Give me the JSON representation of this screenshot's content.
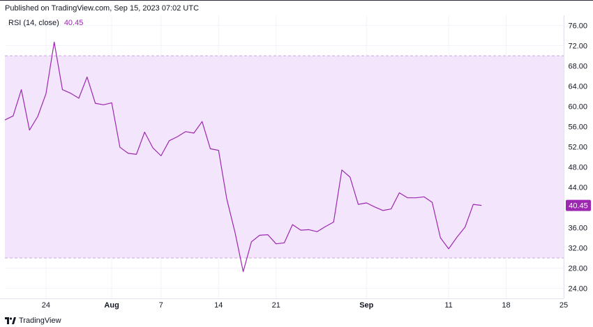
{
  "header": {
    "published_text": "Published on TradingView.com, Sep 15, 2023 07:02 UTC"
  },
  "indicator": {
    "label": "RSI (14, close)",
    "value": "40.45"
  },
  "footer": {
    "brand": "TradingView"
  },
  "colors": {
    "line": "#9c27b0",
    "band_fill": "#f3e5fc",
    "band_border": "#c9a6dd",
    "badge": "#9c27b0",
    "grid": "#f0f3fa"
  },
  "chart_data": {
    "type": "line",
    "title": "RSI (14, close)",
    "xlabel": "",
    "ylabel": "",
    "ylim": [
      22,
      78
    ],
    "y_ticks": [
      "24.00",
      "28.00",
      "32.00",
      "36.00",
      "40.00",
      "44.00",
      "48.00",
      "52.00",
      "56.00",
      "60.00",
      "64.00",
      "68.00",
      "72.00",
      "76.00"
    ],
    "x_ticks": [
      {
        "label": "24",
        "x": "2023-07-24",
        "bold": false
      },
      {
        "label": "Aug",
        "x": "2023-08-01",
        "bold": true
      },
      {
        "label": "7",
        "x": "2023-08-07",
        "bold": false
      },
      {
        "label": "14",
        "x": "2023-08-14",
        "bold": false
      },
      {
        "label": "21",
        "x": "2023-08-21",
        "bold": false
      },
      {
        "label": "Sep",
        "x": "2023-09-01",
        "bold": true
      },
      {
        "label": "11",
        "x": "2023-09-11",
        "bold": false
      },
      {
        "label": "18",
        "x": "2023-09-18",
        "bold": false
      },
      {
        "label": "25",
        "x": "2023-09-25",
        "bold": false
      }
    ],
    "x_range": [
      "2023-07-19",
      "2023-09-25"
    ],
    "band": {
      "upper": 70,
      "lower": 30
    },
    "last_value_label": "40.45",
    "grid": true,
    "series": [
      {
        "name": "RSI (14, close)",
        "x": [
          "2023-07-19",
          "2023-07-20",
          "2023-07-21",
          "2023-07-22",
          "2023-07-23",
          "2023-07-24",
          "2023-07-25",
          "2023-07-26",
          "2023-07-27",
          "2023-07-28",
          "2023-07-29",
          "2023-07-30",
          "2023-07-31",
          "2023-08-01",
          "2023-08-02",
          "2023-08-03",
          "2023-08-04",
          "2023-08-05",
          "2023-08-06",
          "2023-08-07",
          "2023-08-08",
          "2023-08-09",
          "2023-08-10",
          "2023-08-11",
          "2023-08-12",
          "2023-08-13",
          "2023-08-14",
          "2023-08-15",
          "2023-08-16",
          "2023-08-17",
          "2023-08-18",
          "2023-08-19",
          "2023-08-20",
          "2023-08-21",
          "2023-08-22",
          "2023-08-23",
          "2023-08-24",
          "2023-08-25",
          "2023-08-26",
          "2023-08-27",
          "2023-08-28",
          "2023-08-29",
          "2023-08-30",
          "2023-08-31",
          "2023-09-01",
          "2023-09-02",
          "2023-09-03",
          "2023-09-04",
          "2023-09-05",
          "2023-09-06",
          "2023-09-07",
          "2023-09-08",
          "2023-09-09",
          "2023-09-10",
          "2023-09-11",
          "2023-09-12",
          "2023-09-13",
          "2023-09-14",
          "2023-09-15"
        ],
        "values": [
          57.3,
          58.1,
          63.3,
          55.3,
          58.0,
          62.5,
          72.7,
          63.3,
          62.6,
          61.6,
          65.8,
          60.6,
          60.3,
          60.7,
          51.9,
          50.7,
          50.5,
          54.9,
          51.8,
          50.2,
          53.2,
          54.0,
          55.0,
          54.7,
          57.0,
          51.6,
          51.3,
          41.7,
          35.1,
          27.3,
          33.2,
          34.5,
          34.6,
          32.8,
          33.0,
          36.6,
          35.5,
          35.6,
          35.2,
          36.2,
          37.1,
          47.4,
          46.0,
          40.6,
          40.9,
          40.1,
          39.4,
          39.7,
          42.9,
          41.9,
          41.9,
          42.1,
          41.0,
          34.0,
          31.8,
          34.1,
          36.1,
          40.6,
          40.4
        ]
      }
    ]
  }
}
